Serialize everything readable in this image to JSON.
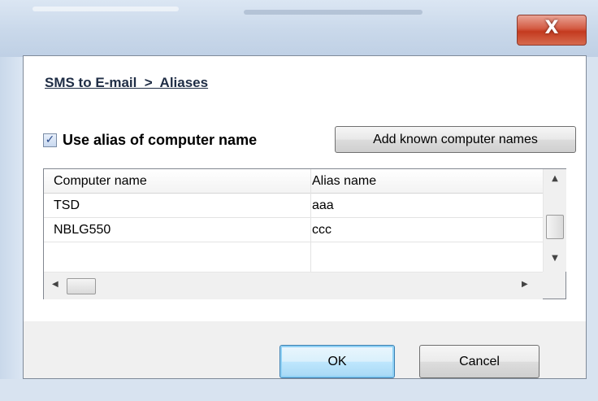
{
  "window": {
    "close_glyph": "X"
  },
  "breadcrumb": {
    "text": "SMS to E-mail  >  Aliases"
  },
  "alias_option": {
    "checked": true,
    "label": "Use alias of computer name"
  },
  "add_button": {
    "label": "Add known computer names"
  },
  "table": {
    "columns": [
      "Computer name",
      "Alias name"
    ],
    "rows": [
      {
        "computer": "TSD",
        "alias": "aaa"
      },
      {
        "computer": "NBLG550",
        "alias": "ccc"
      }
    ]
  },
  "footer": {
    "ok_label": "OK",
    "cancel_label": "Cancel"
  }
}
